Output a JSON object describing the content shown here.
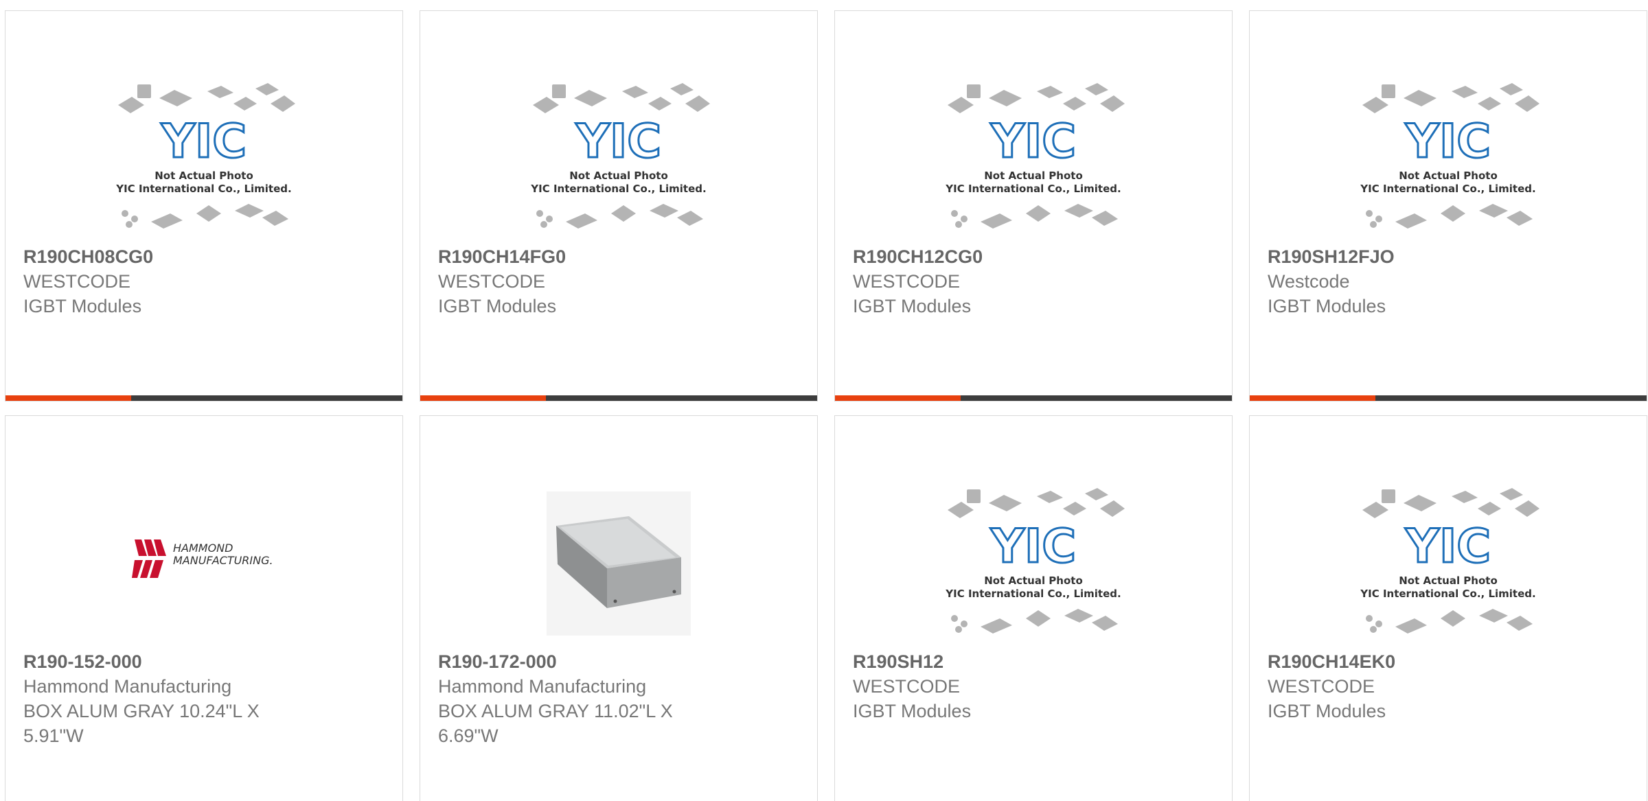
{
  "products": [
    {
      "part": "R190CH08CG0",
      "manufacturer": "WESTCODE",
      "description": "IGBT Modules",
      "image": "yic-placeholder-image",
      "caption1": "Not Actual Photo",
      "caption2": "YIC International Co., Limited.",
      "logo_text": "YIC"
    },
    {
      "part": "R190CH14FG0",
      "manufacturer": "WESTCODE",
      "description": "IGBT Modules",
      "image": "yic-placeholder-image",
      "caption1": "Not Actual Photo",
      "caption2": "YIC International Co., Limited.",
      "logo_text": "YIC"
    },
    {
      "part": "R190CH12CG0",
      "manufacturer": "WESTCODE",
      "description": "IGBT Modules",
      "image": "yic-placeholder-image",
      "caption1": "Not Actual Photo",
      "caption2": "YIC International Co., Limited.",
      "logo_text": "YIC"
    },
    {
      "part": "R190SH12FJO",
      "manufacturer": "Westcode",
      "description": "IGBT Modules",
      "image": "yic-placeholder-image",
      "caption1": "Not Actual Photo",
      "caption2": "YIC International Co., Limited.",
      "logo_text": "YIC"
    },
    {
      "part": "R190-152-000",
      "manufacturer": "Hammond Manufacturing",
      "description": "BOX ALUM GRAY 10.24\"L X 5.91\"W",
      "image": "hammond-logo",
      "logo_line1": "HAMMOND",
      "logo_line2": "MANUFACTURING."
    },
    {
      "part": "R190-172-000",
      "manufacturer": "Hammond Manufacturing",
      "description": "BOX ALUM GRAY 11.02\"L X 6.69\"W",
      "image": "gray-enclosure-photo"
    },
    {
      "part": "R190SH12",
      "manufacturer": "WESTCODE",
      "description": "IGBT Modules",
      "image": "yic-placeholder-image",
      "caption1": "Not Actual Photo",
      "caption2": "YIC International Co., Limited.",
      "logo_text": "YIC"
    },
    {
      "part": "R190CH14EK0",
      "manufacturer": "WESTCODE",
      "description": "IGBT Modules",
      "image": "yic-placeholder-image",
      "caption1": "Not Actual Photo",
      "caption2": "YIC International Co., Limited.",
      "logo_text": "YIC"
    }
  ],
  "colors": {
    "accent": "#e8410f",
    "bar": "#3d3d3d",
    "yic_blue": "#1e6fb8",
    "chip_gray": "#b4b4b4",
    "hammond_red": "#c8102e"
  }
}
